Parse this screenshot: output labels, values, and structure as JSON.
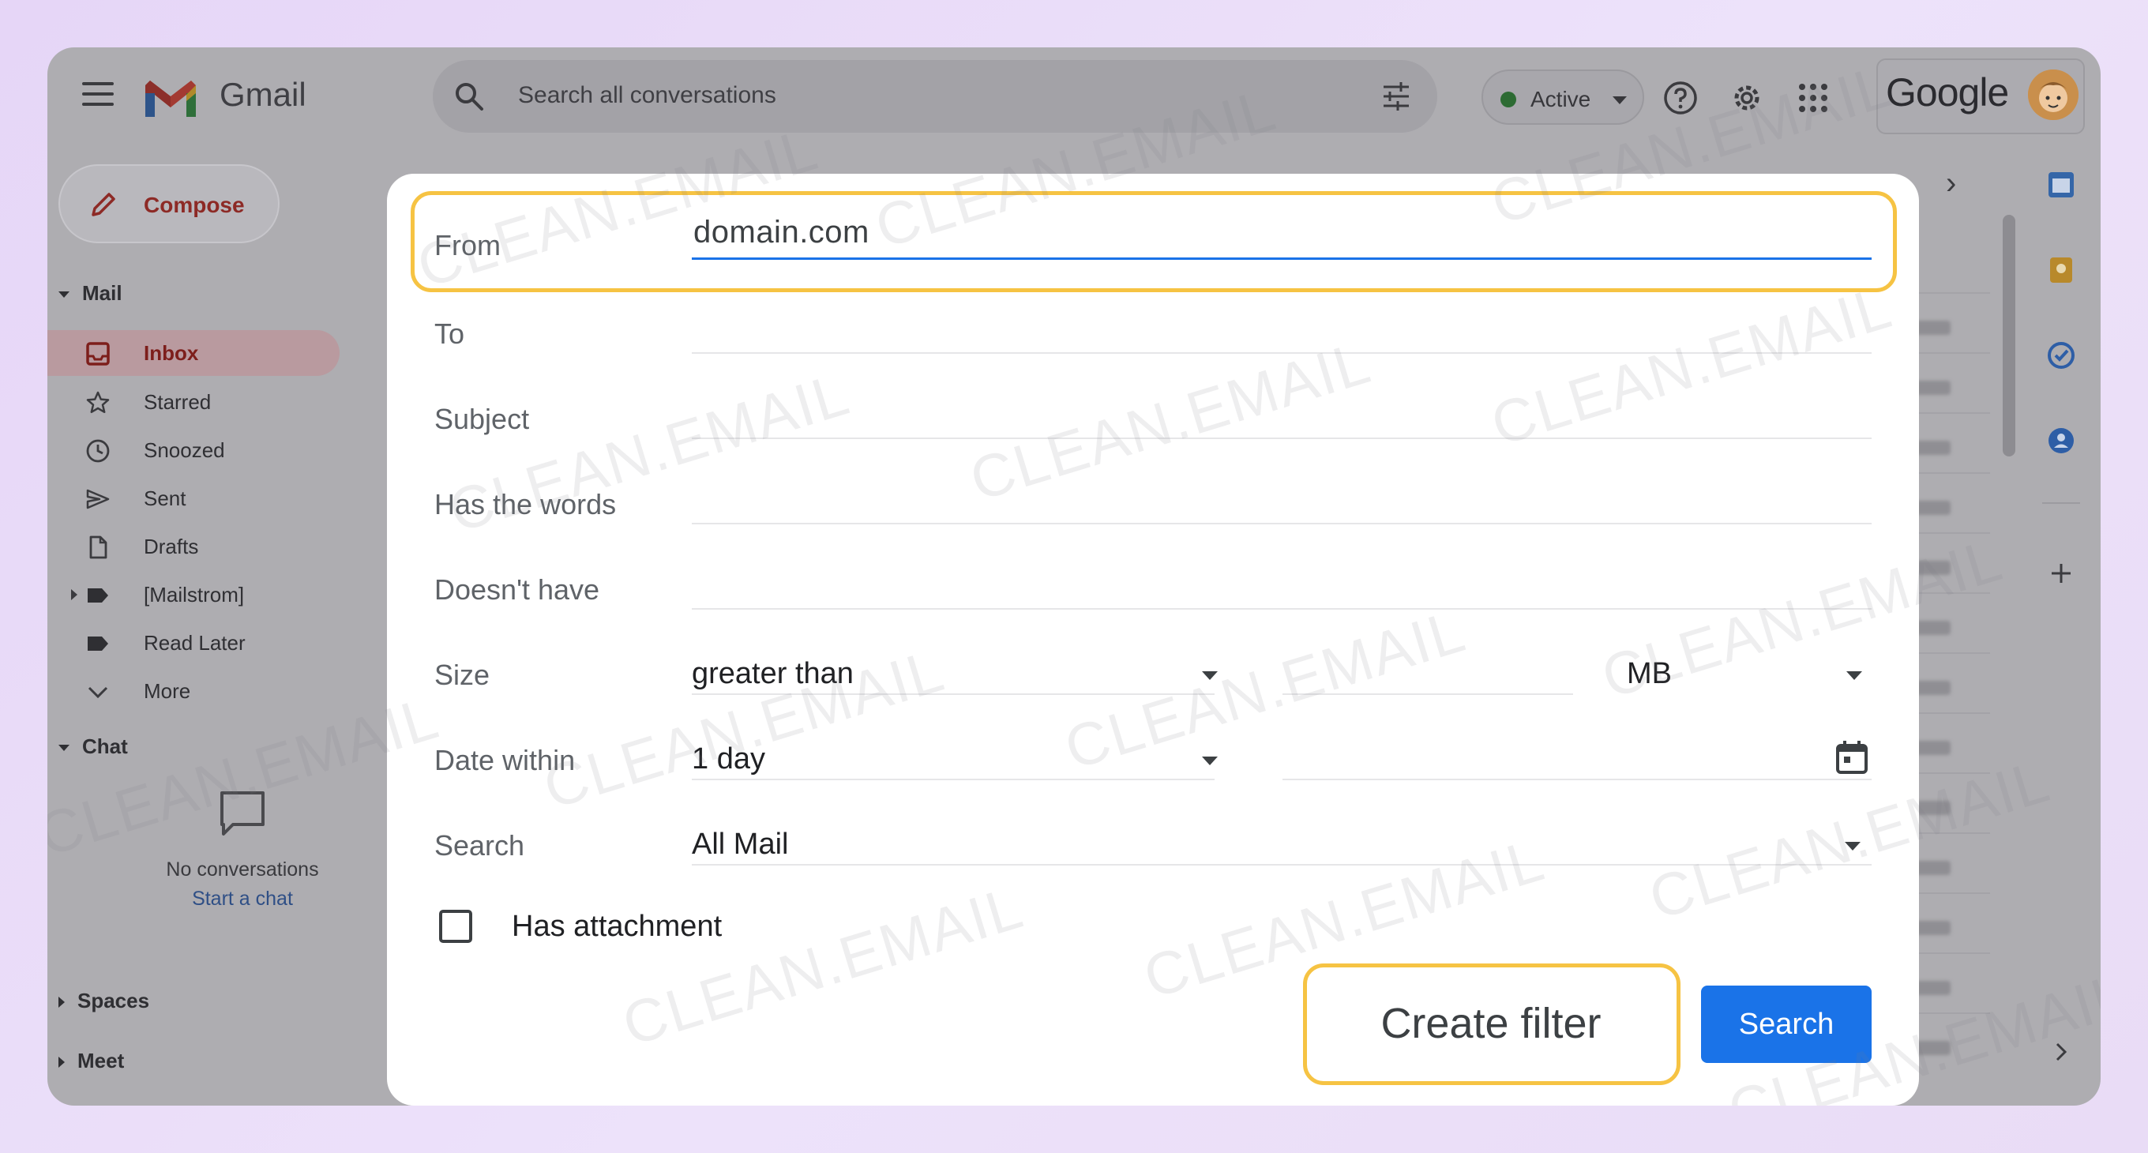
{
  "app": {
    "name": "Gmail",
    "search_placeholder": "Search all conversations",
    "status": "Active",
    "brand": "Google"
  },
  "sidebar": {
    "compose": "Compose",
    "mail_header": "Mail",
    "items": [
      {
        "label": "Inbox",
        "icon": "inbox-icon"
      },
      {
        "label": "Starred",
        "icon": "star-icon"
      },
      {
        "label": "Snoozed",
        "icon": "clock-icon"
      },
      {
        "label": "Sent",
        "icon": "send-icon"
      },
      {
        "label": "Drafts",
        "icon": "draft-icon"
      },
      {
        "label": "[Mailstrom]",
        "icon": "label-icon"
      },
      {
        "label": "Read Later",
        "icon": "label-icon"
      },
      {
        "label": "More",
        "icon": "chevron-down-icon"
      }
    ],
    "chat_header": "Chat",
    "chat_empty": "No conversations",
    "chat_link": "Start a chat",
    "spaces_header": "Spaces",
    "meet_header": "Meet"
  },
  "filter": {
    "from_label": "From",
    "from_value": "domain.com",
    "to_label": "To",
    "subject_label": "Subject",
    "has_words_label": "Has the words",
    "doesnt_have_label": "Doesn't have",
    "size_label": "Size",
    "size_operator": "greater than",
    "size_unit": "MB",
    "date_label": "Date within",
    "date_value": "1 day",
    "search_label": "Search",
    "search_value": "All Mail",
    "attachment_label": "Has attachment",
    "attachment_checked": false,
    "create_filter": "Create filter",
    "search_button": "Search"
  },
  "watermark": "CLEAN.EMAIL",
  "colors": {
    "highlight": "#f6c343",
    "primary": "#1a73e8",
    "gmail_red": "#ea4335"
  }
}
